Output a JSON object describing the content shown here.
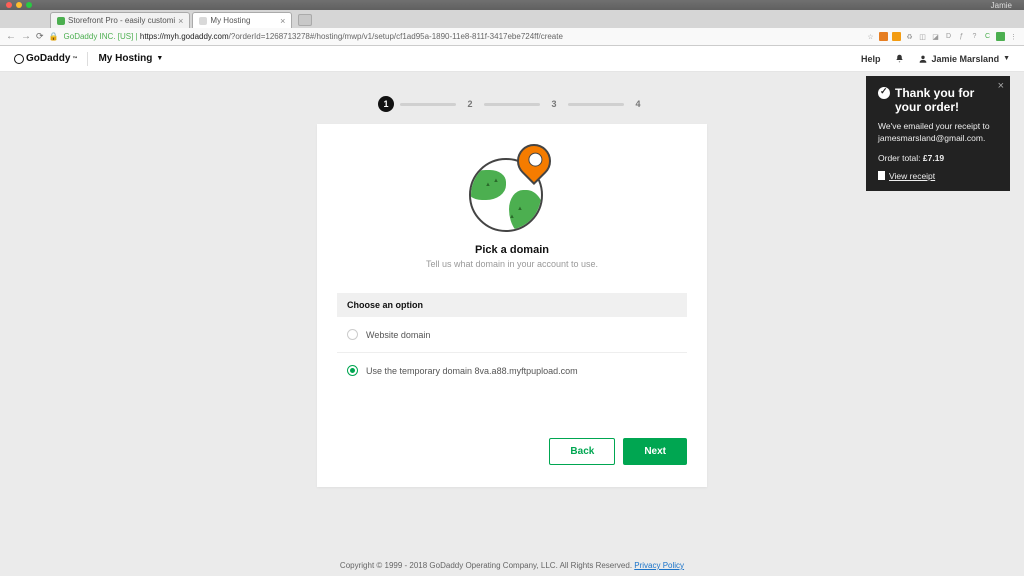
{
  "browser": {
    "profile": "Jamie",
    "tabs": [
      {
        "title": "Storefront Pro - easily customi",
        "active": false
      },
      {
        "title": "My Hosting",
        "active": true
      }
    ],
    "url_secure_label": "GoDaddy INC. [US]",
    "url_host": "https://myh.godaddy.com",
    "url_path": "/?orderId=1268713278#/hosting/mwp/v1/setup/cf1ad95a-1890-11e8-811f-3417ebe724ff/create"
  },
  "header": {
    "brand": "GoDaddy",
    "nav_label": "My Hosting",
    "help": "Help",
    "user": "Jamie Marsland"
  },
  "stepper": {
    "steps": [
      "1",
      "2",
      "3",
      "4"
    ],
    "active_index": 0
  },
  "card": {
    "title": "Pick a domain",
    "subtitle": "Tell us what domain in your account to use.",
    "option_header": "Choose an option",
    "option1": "Website domain",
    "option2": "Use the temporary domain 8va.a88.myftpupload.com",
    "back": "Back",
    "next": "Next"
  },
  "toast": {
    "title": "Thank you for your order!",
    "body_prefix": "We've emailed your receipt to ",
    "email": "jamesmarsland@gmail.com",
    "body_suffix": ".",
    "total_label": "Order total: ",
    "total_value": "£7.19",
    "link": "View receipt"
  },
  "footer": {
    "text": "Copyright © 1999 - 2018 GoDaddy Operating Company, LLC. All Rights Reserved. ",
    "link": "Privacy Policy"
  }
}
